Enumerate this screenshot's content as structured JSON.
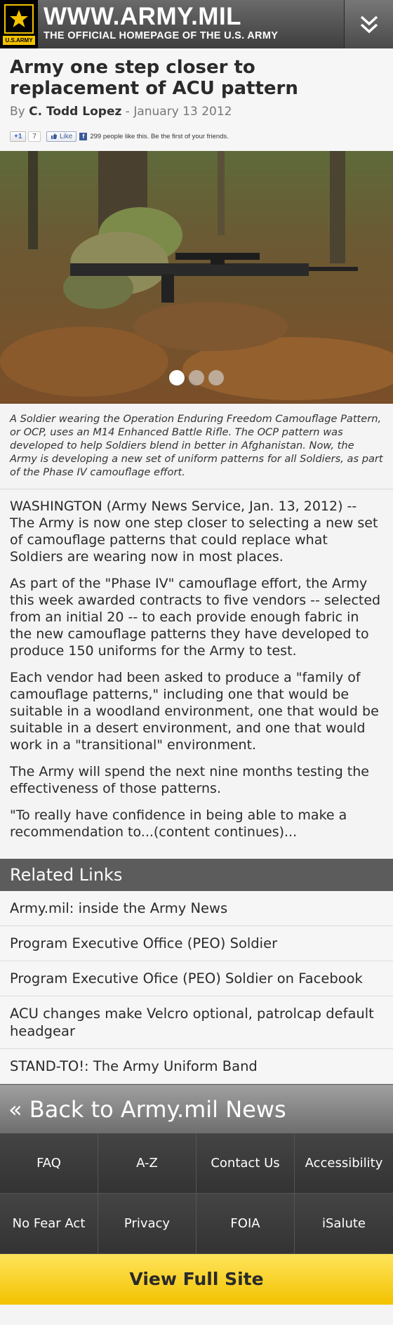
{
  "header": {
    "logo_text": "U.S.ARMY",
    "site_name": "WWW.ARMY.MIL",
    "tagline": "THE OFFICIAL HOMEPAGE OF THE U.S. ARMY",
    "menu_icon": "double-chevron-down-icon"
  },
  "article": {
    "title": "Army one step closer to replacement of ACU pattern",
    "by_label": "By",
    "author": "C. Todd Lopez",
    "separator": " - ",
    "date": "January 13 2012",
    "social": {
      "gplus_label": "+1",
      "gplus_count": "7",
      "fb_like_label": "Like",
      "fb_text": "299 people like this. Be the first of your friends."
    },
    "caption": "A Soldier wearing the Operation Enduring Freedom Camouflage Pattern, or OCP, uses an M14 Enhanced Battle Rifle. The OCP pattern was developed to help Soldiers blend in better in Afghanistan. Now, the Army is developing a new set of uniform patterns for all Soldiers, as part of the Phase IV camouflage effort.",
    "slides": {
      "count": 3,
      "active": 1
    },
    "paragraphs": [
      "WASHINGTON (Army News Service, Jan. 13, 2012) -- The Army is now one step closer to selecting a new set of camouflage patterns that could replace what Soldiers are wearing now in most places.",
      "As part of the \"Phase IV\" camouflage effort, the Army this week awarded contracts to five vendors -- selected from an initial 20 -- to each provide enough fabric in the new camouflage patterns they have developed to produce 150 uniforms for the Army to test.",
      "Each vendor had been asked to produce a \"family of camouflage patterns,\" including one that would be suitable in a woodland environment, one that would be suitable in a desert environment, and one that would work in a \"transitional\" environment.",
      "The Army will spend the next nine months testing the effectiveness of those patterns.",
      "\"To really have confidence in being able to make a recommendation to...(content continues)..."
    ]
  },
  "related": {
    "heading": "Related Links",
    "links": [
      "Army.mil: inside the Army News",
      "Program Executive Office (PEO) Soldier",
      "Program Executive Ofice (PEO) Soldier on Facebook",
      "ACU changes make Velcro optional, patrolcap default headgear",
      "STAND-TO!: The Army Uniform Band"
    ]
  },
  "back_link": "« Back to Army.mil News",
  "footer": {
    "links": [
      "FAQ",
      "A-Z",
      "Contact Us",
      "Accessibility",
      "No Fear Act",
      "Privacy",
      "FOIA",
      "iSalute"
    ],
    "full_site": "View Full Site"
  },
  "colors": {
    "header_dark": "#3e3e3e",
    "army_gold": "#f2c200",
    "section_gray": "#5c5c5c",
    "full_site_yellow": "#ffe45c"
  }
}
